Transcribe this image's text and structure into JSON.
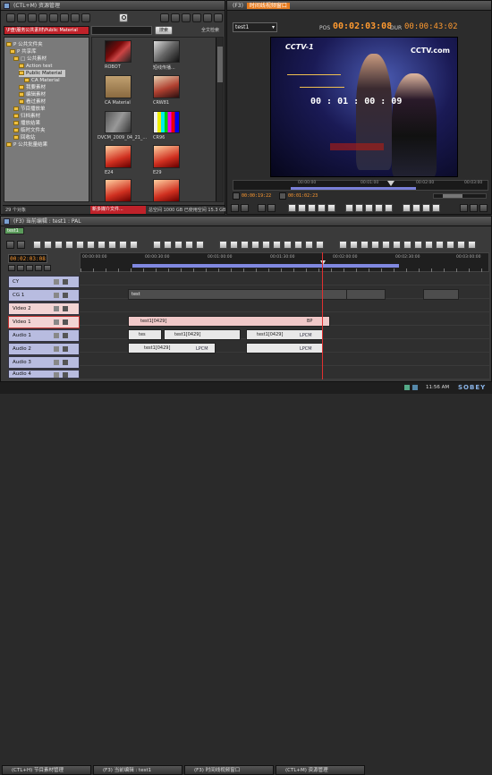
{
  "browser": {
    "title": "(CTL+M) 资源管理",
    "path": "\\P盘\\服务公共素材\\Public Material",
    "search_button": "搜索",
    "fulltext_button": "全文检索",
    "tree": [
      "P 公共文件夹",
      "P 共享库",
      "□ 公共素材",
      "Action test",
      "Public Material",
      "CA Material",
      "我要素材",
      "编辑素材",
      "看过素材",
      "节目播放单",
      "归档素材",
      "播放结果",
      "临时文件夹",
      "回收站",
      "P 公共批量结果"
    ],
    "thumbnails": [
      {
        "label": "ROBOT"
      },
      {
        "label": "短线传播..."
      },
      {
        "label": "CA Material"
      },
      {
        "label": "CRW81"
      },
      {
        "label": "DVCM_2009_04_21_..."
      },
      {
        "label": "CR96"
      },
      {
        "label": "E24"
      },
      {
        "label": "E29"
      },
      {
        "label": ""
      },
      {
        "label": ""
      }
    ],
    "status_count": "29 个对象",
    "status_alert": "新多媒介文件...",
    "status_space": "总空间 1000 GB 已使用空间 15.3 GB"
  },
  "viewer": {
    "title": "时间线视频窗口",
    "title_prefix": "(F3)",
    "clip_select": "test1",
    "pos_label": "POS",
    "pos_time": "00:02:03:08",
    "dur_label": "DUR",
    "dur_time": "00:00:43:02",
    "overlay_time": "00 : 01 : 00 : 09",
    "cctv_logo": "CCTV-1",
    "cctv_right": "CCTV.com",
    "tc_in": "00:00:19:22",
    "tc_out": "00:01:02:23",
    "ruler_labels": [
      "00:00:00",
      "00:01:00",
      "00:02:00",
      "00:03:00"
    ]
  },
  "timeline": {
    "title": "(F3) 当前编辑 : test1 : PAL",
    "tab": "test1",
    "timecode": "00:02:03:08",
    "ruler_labels": [
      "00:00:00:00",
      "00:00:30:00",
      "00:01:00:00",
      "00:01:30:00",
      "00:02:00:00",
      "00:02:30:00",
      "00:03:00:00"
    ],
    "tracks": [
      {
        "name": "CY",
        "color": "#b8bce0"
      },
      {
        "name": "CG 1",
        "color": "#b8bce0"
      },
      {
        "name": "Video 2",
        "color": "#f2d4d4"
      },
      {
        "name": "Video 1",
        "color": "#f2d4d4"
      },
      {
        "name": "Audio 1",
        "color": "#b8bce0"
      },
      {
        "name": "Audio 2",
        "color": "#b8bce0"
      },
      {
        "name": "Audio 3",
        "color": "#b8bce0"
      },
      {
        "name": "Audio 4",
        "color": "#b8bce0"
      }
    ],
    "clips": {
      "cg_a": "test",
      "v1_a": "test1[0429]",
      "a1_a": "tes",
      "a1_b": "test1[0429]",
      "a1_c": "test1[0429]",
      "a2_a": "test1[0429]",
      "lpcm1": "LPCM",
      "lpcm2": "LPCM",
      "lpcm3": "LPCM",
      "bp": "BP"
    }
  },
  "taskbar": {
    "items": [
      "(CTL+H) 节目素材管理",
      "(F3) 当前编辑 : test1",
      "(F3) 时间线视频窗口",
      "(CTL+M) 资源管理"
    ],
    "clock": "11:56 AM",
    "brand": "SOBEY"
  },
  "colors": {
    "accent_red": "#c0222a",
    "timecode_orange": "#ff9a30",
    "playhead": "#e03030"
  }
}
